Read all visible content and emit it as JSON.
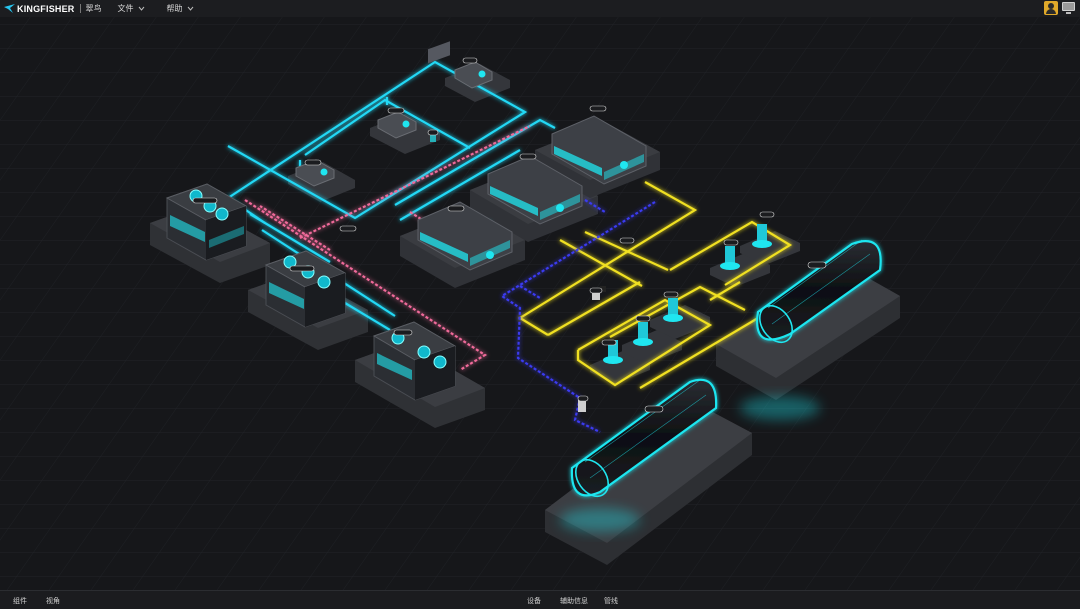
{
  "app": {
    "brand": "KINGFISHER",
    "subtitle": "翠鸟"
  },
  "menu": {
    "file": "文件",
    "help": "帮助"
  },
  "toolbar": {
    "tools": [
      {
        "icon": "edit-icon"
      },
      {
        "icon": "arch-view-icon"
      },
      {
        "icon": "save-icon"
      },
      {
        "icon": "navigate-arrow-icon"
      },
      {
        "icon": "upload-icon"
      },
      {
        "icon": "fullscreen-icon"
      },
      {
        "icon": "info-icon"
      }
    ]
  },
  "bottom_bar": {
    "left": [
      "组件",
      "视角"
    ],
    "center": [
      "设备",
      "辅助信息",
      "管线"
    ]
  },
  "colors": {
    "cooling_water": "#22d8f5",
    "chilled_water_supply": "#f0e020",
    "chilled_water_return": "#3a3af0",
    "condensate": "#f06a9a",
    "equipment_glow": "#1fe6f0"
  }
}
